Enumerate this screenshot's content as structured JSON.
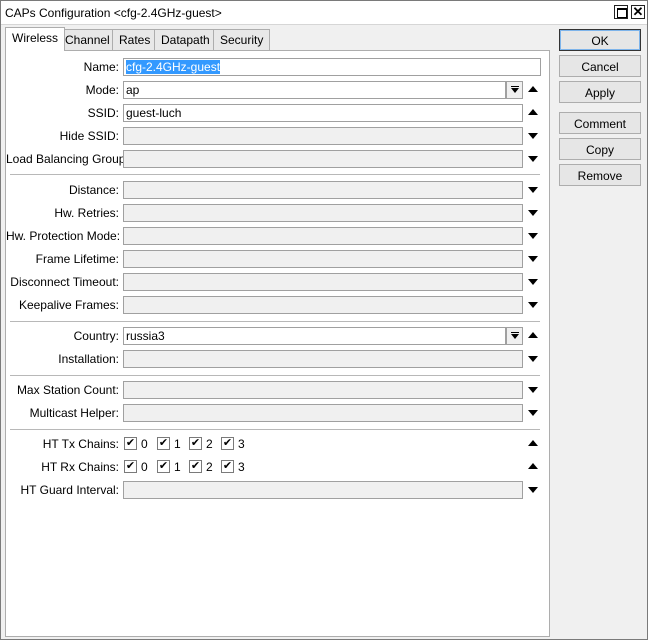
{
  "window": {
    "title": "CAPs Configuration <cfg-2.4GHz-guest>",
    "close_glyph": "✕",
    "maximize_icon": "maximize-icon",
    "close_icon": "close-icon"
  },
  "tabs": [
    {
      "label": "Wireless",
      "active": true
    },
    {
      "label": "Channel"
    },
    {
      "label": "Rates"
    },
    {
      "label": "Datapath"
    },
    {
      "label": "Security"
    }
  ],
  "fields": {
    "name": {
      "label": "Name:",
      "value": "cfg-2.4GHz-guest"
    },
    "mode": {
      "label": "Mode:",
      "value": "ap"
    },
    "ssid": {
      "label": "SSID:",
      "value": "guest-luch"
    },
    "hide_ssid": {
      "label": "Hide SSID:",
      "value": ""
    },
    "load_balancing_group": {
      "label": "Load Balancing Group:",
      "value": ""
    },
    "distance": {
      "label": "Distance:",
      "value": ""
    },
    "hw_retries": {
      "label": "Hw. Retries:",
      "value": ""
    },
    "hw_protection_mode": {
      "label": "Hw. Protection Mode:",
      "value": ""
    },
    "frame_lifetime": {
      "label": "Frame Lifetime:",
      "value": ""
    },
    "disconnect_timeout": {
      "label": "Disconnect Timeout:",
      "value": ""
    },
    "keepalive_frames": {
      "label": "Keepalive Frames:",
      "value": ""
    },
    "country": {
      "label": "Country:",
      "value": "russia3"
    },
    "installation": {
      "label": "Installation:",
      "value": ""
    },
    "max_station_count": {
      "label": "Max Station Count:",
      "value": ""
    },
    "multicast_helper": {
      "label": "Multicast Helper:",
      "value": ""
    },
    "ht_tx_chains": {
      "label": "HT Tx Chains:",
      "chains": [
        "0",
        "1",
        "2",
        "3"
      ],
      "checked": [
        true,
        true,
        true,
        true
      ]
    },
    "ht_rx_chains": {
      "label": "HT Rx Chains:",
      "chains": [
        "0",
        "1",
        "2",
        "3"
      ],
      "checked": [
        true,
        true,
        true,
        true
      ]
    },
    "ht_guard_interval": {
      "label": "HT Guard Interval:",
      "value": ""
    }
  },
  "buttons": {
    "ok": "OK",
    "cancel": "Cancel",
    "apply": "Apply",
    "comment": "Comment",
    "copy": "Copy",
    "remove": "Remove"
  },
  "check_glyph": "✔"
}
